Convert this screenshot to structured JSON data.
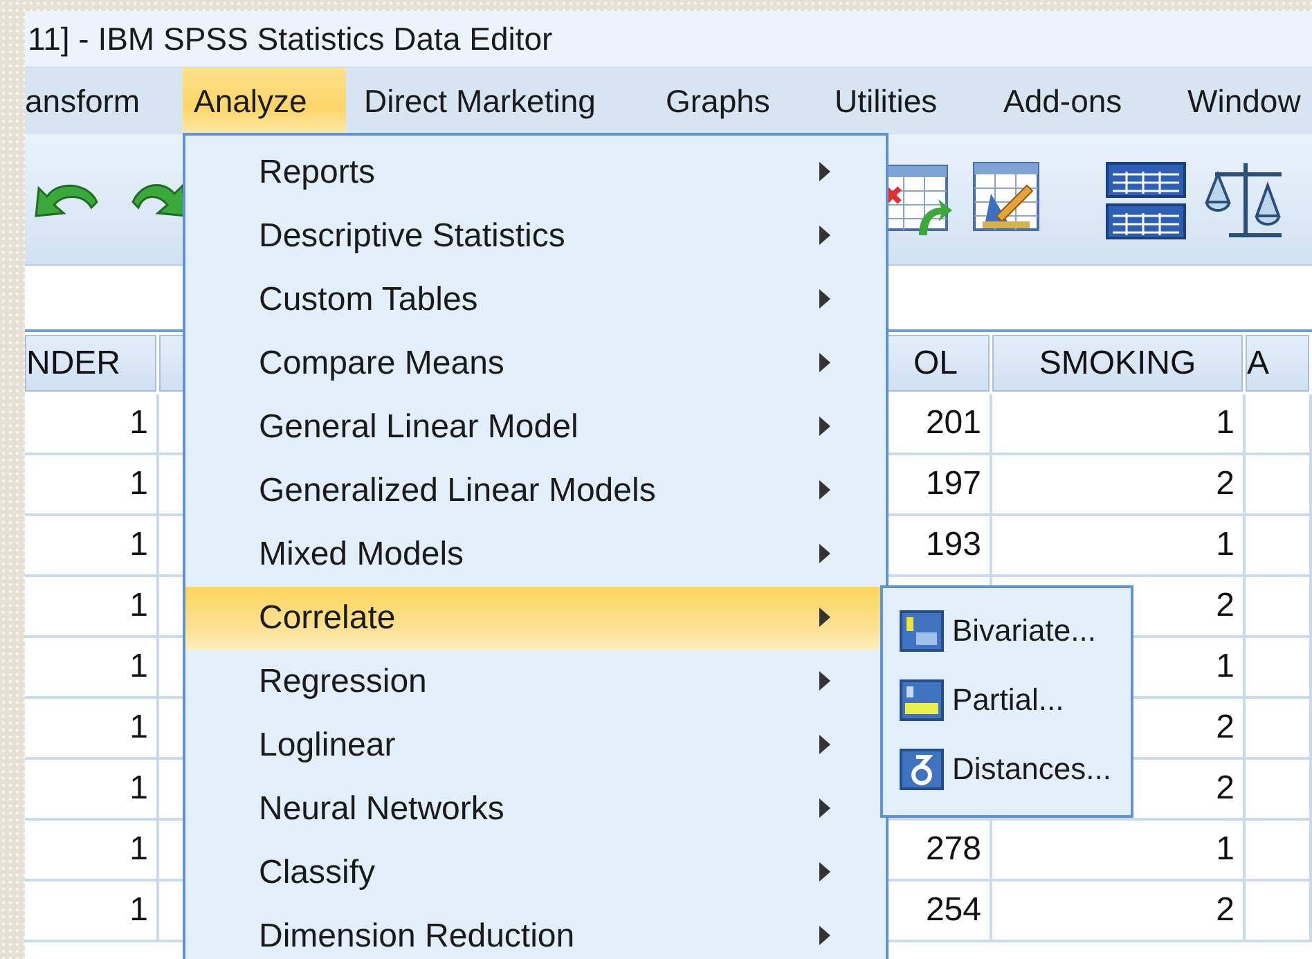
{
  "window": {
    "title": "11] - IBM SPSS Statistics Data Editor"
  },
  "menu_bar": [
    {
      "label": "ansform",
      "selected": false
    },
    {
      "label": "Analyze",
      "selected": true
    },
    {
      "label": "Direct Marketing",
      "selected": false
    },
    {
      "label": "Graphs",
      "selected": false
    },
    {
      "label": "Utilities",
      "selected": false
    },
    {
      "label": "Add-ons",
      "selected": false
    },
    {
      "label": "Window",
      "selected": false
    }
  ],
  "toolbar": [
    {
      "kind": "undo"
    },
    {
      "kind": "redo"
    },
    {
      "kind": "gap"
    },
    {
      "kind": "insert-cases"
    },
    {
      "kind": "edit-table"
    },
    {
      "kind": "split-table"
    },
    {
      "kind": "scales"
    }
  ],
  "table": {
    "columns": [
      "NDER",
      null,
      "OL",
      "SMOKING",
      "A"
    ],
    "rows": [
      [
        "1",
        null,
        "201",
        "1"
      ],
      [
        "1",
        null,
        "197",
        "2"
      ],
      [
        "1",
        null,
        "193",
        "1"
      ],
      [
        "1",
        null,
        null,
        "2"
      ],
      [
        "1",
        null,
        null,
        "1"
      ],
      [
        "1",
        null,
        null,
        "2"
      ],
      [
        "1",
        null,
        null,
        "2"
      ],
      [
        "1",
        null,
        "278",
        "1"
      ],
      [
        "1",
        null,
        "254",
        "2"
      ]
    ]
  },
  "analyze_menu": {
    "items": [
      {
        "label": "Reports",
        "selected": false
      },
      {
        "label": "Descriptive Statistics",
        "selected": false
      },
      {
        "label": "Custom Tables",
        "selected": false
      },
      {
        "label": "Compare Means",
        "selected": false
      },
      {
        "label": "General Linear Model",
        "selected": false
      },
      {
        "label": "Generalized Linear Models",
        "selected": false
      },
      {
        "label": "Mixed Models",
        "selected": false
      },
      {
        "label": "Correlate",
        "selected": true
      },
      {
        "label": "Regression",
        "selected": false
      },
      {
        "label": "Loglinear",
        "selected": false
      },
      {
        "label": "Neural Networks",
        "selected": false
      },
      {
        "label": "Classify",
        "selected": false
      },
      {
        "label": "Dimension Reduction",
        "selected": false
      }
    ]
  },
  "correlate_submenu": {
    "items": [
      {
        "label": "Bivariate...",
        "kind": "bivariate"
      },
      {
        "label": "Partial...",
        "kind": "partial"
      },
      {
        "label": "Distances...",
        "kind": "distances"
      }
    ]
  }
}
